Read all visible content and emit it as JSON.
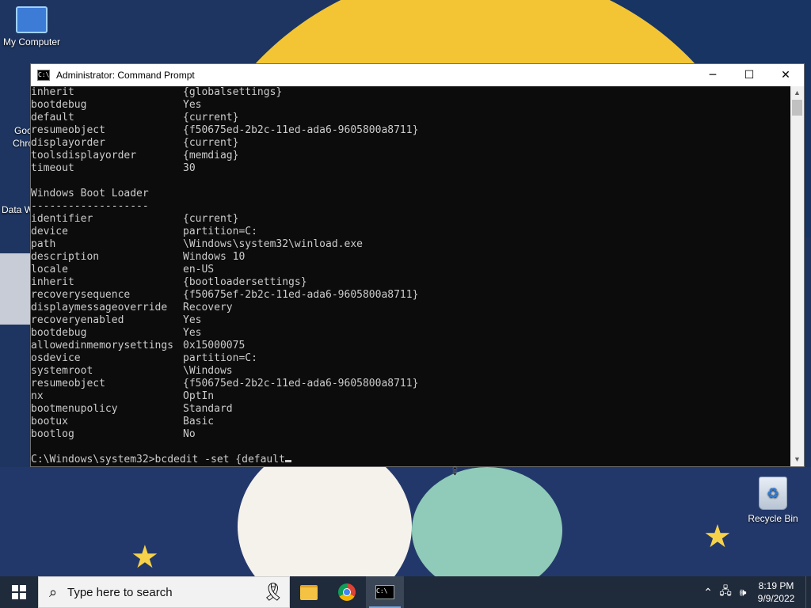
{
  "desktop": {
    "icons": [
      {
        "label": "My Computer"
      },
      {
        "label": "Recycle Bin"
      }
    ],
    "partial_labels": [
      "Goo",
      "Chro",
      "Data W"
    ]
  },
  "window": {
    "title": "Administrator: Command Prompt",
    "title_icon_text": "C:\\",
    "controls": {
      "minimize": "─",
      "maximize": "☐",
      "close": "✕"
    }
  },
  "console": {
    "rows": [
      {
        "key": "inherit",
        "value": "{globalsettings}"
      },
      {
        "key": "bootdebug",
        "value": "Yes"
      },
      {
        "key": "default",
        "value": "{current}"
      },
      {
        "key": "resumeobject",
        "value": "{f50675ed-2b2c-11ed-ada6-9605800a8711}"
      },
      {
        "key": "displayorder",
        "value": "{current}"
      },
      {
        "key": "toolsdisplayorder",
        "value": "{memdiag}"
      },
      {
        "key": "timeout",
        "value": "30"
      },
      {
        "key": "",
        "value": ""
      },
      {
        "key": "Windows Boot Loader",
        "value": ""
      },
      {
        "key": "-------------------",
        "value": ""
      },
      {
        "key": "identifier",
        "value": "{current}"
      },
      {
        "key": "device",
        "value": "partition=C:"
      },
      {
        "key": "path",
        "value": "\\Windows\\system32\\winload.exe"
      },
      {
        "key": "description",
        "value": "Windows 10"
      },
      {
        "key": "locale",
        "value": "en-US"
      },
      {
        "key": "inherit",
        "value": "{bootloadersettings}"
      },
      {
        "key": "recoverysequence",
        "value": "{f50675ef-2b2c-11ed-ada6-9605800a8711}"
      },
      {
        "key": "displaymessageoverride",
        "value": "Recovery"
      },
      {
        "key": "recoveryenabled",
        "value": "Yes"
      },
      {
        "key": "bootdebug",
        "value": "Yes"
      },
      {
        "key": "allowedinmemorysettings",
        "value": "0x15000075"
      },
      {
        "key": "osdevice",
        "value": "partition=C:"
      },
      {
        "key": "systemroot",
        "value": "\\Windows"
      },
      {
        "key": "resumeobject",
        "value": "{f50675ed-2b2c-11ed-ada6-9605800a8711}"
      },
      {
        "key": "nx",
        "value": "OptIn"
      },
      {
        "key": "bootmenupolicy",
        "value": "Standard"
      },
      {
        "key": "bootux",
        "value": "Basic"
      },
      {
        "key": "bootlog",
        "value": "No"
      },
      {
        "key": "",
        "value": ""
      }
    ],
    "prompt": "C:\\Windows\\system32>",
    "command": "bcdedit -set {default"
  },
  "taskbar": {
    "search_placeholder": "Type here to search",
    "apps": [
      {
        "icon": "file-explorer-icon",
        "active": false
      },
      {
        "icon": "chrome-icon",
        "active": false
      },
      {
        "icon": "command-prompt-icon",
        "active": true
      }
    ],
    "tray": {
      "time": "8:19 PM",
      "date": "9/9/2022"
    }
  },
  "colors": {
    "console_bg": "#0c0c0c",
    "console_fg": "#cccccc",
    "taskbar_bg": "#1f2a3a"
  }
}
